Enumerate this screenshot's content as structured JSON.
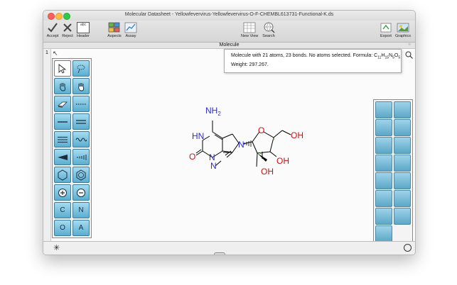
{
  "window": {
    "title": "Molecular Datasheet - Yellowfevervirus-Yellowfevervirus-O-F-CHEMBL613731-Functional-K.ds"
  },
  "toolbar": {
    "accept": "Accept",
    "reject": "Reject",
    "header": "Header",
    "header_icon_text": "abc",
    "aspects": "Aspects",
    "assay": "Assay",
    "new_view": "New View",
    "search": "Search",
    "export": "Export",
    "graphics": "Graphics"
  },
  "sheet": {
    "header": "Molecule",
    "row_number": "1"
  },
  "info": {
    "line1_prefix": "Molecule with 21 atoms, 23 bonds. No atoms selected. Formula: C",
    "c_count": "11",
    "h_label": "H",
    "h_count": "15",
    "n_label": "N",
    "n_count": "5",
    "o_label": "O",
    "o_count": "5",
    "line2": "Weight: 297.267."
  },
  "palette": {
    "c_label": "C",
    "n_label": "N",
    "o_label": "O",
    "a_label": "A"
  },
  "molecule": {
    "labels": {
      "nh2_n": "NH",
      "nh2_sub": "2",
      "hn": "HN",
      "o_carbonyl": "O",
      "n7": "N",
      "n9": "N",
      "n3": "N",
      "o_ring": "O",
      "oh_ch2": "OH",
      "oh_c3": "OH",
      "oh_c2": "OH"
    },
    "colors": {
      "nitrogen": "#2b2bd6",
      "oxygen": "#d11010",
      "bond": "#000000",
      "stereo": "#5a9a3a"
    }
  }
}
